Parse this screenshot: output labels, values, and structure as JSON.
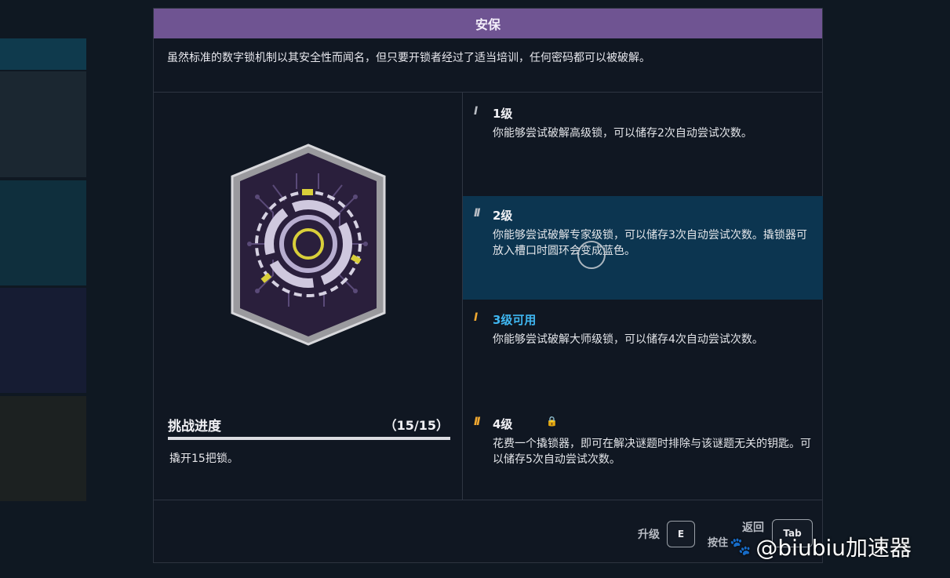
{
  "window": {
    "title": "安保"
  },
  "description": "虽然标准的数字锁机制以其安全性而闻名，但只要开锁者经过了适当培训，任何密码都可以被破解。",
  "progress": {
    "title": "挑战进度",
    "count": "（15/15）",
    "value": 1.0,
    "description": "撬开15把锁。"
  },
  "tiers": [
    {
      "mark": "I",
      "title": "1级",
      "body": "你能够尝试破解高级锁，可以储存2次自动尝试次数。",
      "mark_color": "#b9bdc4",
      "active": false
    },
    {
      "mark": "II",
      "title": "2级",
      "body": "你能够尝试破解专家级锁，可以储存3次自动尝试次数。撬锁器可放入槽口时圆环会变成蓝色。",
      "mark_color": "#b9bdc4",
      "active": true
    },
    {
      "mark": "I",
      "title": "3级可用",
      "body": "你能够尝试破解大师级锁，可以储存4次自动尝试次数。",
      "mark_color": "#f0a830",
      "title_color": "#3fb6f0",
      "active": false
    },
    {
      "mark": "II",
      "title": "4级",
      "body": "花费一个撬锁器，即可在解决谜题时排除与该谜题无关的钥匙。可以储存5次自动尝试次数。",
      "mark_color": "#f0a830",
      "locked": true,
      "lock_icon": "lock-icon",
      "active": false
    }
  ],
  "footer": {
    "upgrade_label": "升级",
    "upgrade_key": "E",
    "hold_label": "按住",
    "back_label": "返回",
    "back_key": "Tab"
  },
  "watermark": {
    "text": "@biubiu加速器",
    "icon": "paw-icon"
  },
  "colors": {
    "title_bar": "#6f5492",
    "active_tier": "#0c3550",
    "badge_purple": "#2a1f3c",
    "badge_yellow": "#d9cf3a"
  }
}
